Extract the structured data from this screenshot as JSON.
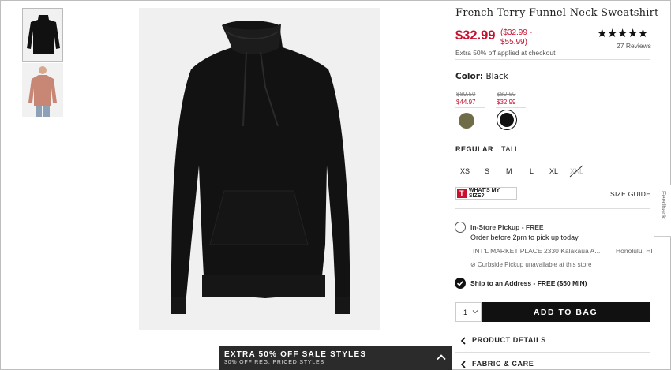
{
  "product": {
    "title": "French Terry Funnel-Neck Sweatshirt",
    "price": "$32.99",
    "price_range": "($32.99 - $55.99)",
    "extra_discount": "Extra 50% off applied at checkout",
    "rating": "★★★★★",
    "reviews": "27 Reviews"
  },
  "color": {
    "label": "Color:",
    "value": "Black",
    "swatches": [
      {
        "orig": "$89.50",
        "sale": "$44.97",
        "color": "#6f6d48"
      },
      {
        "orig": "$89.50",
        "sale": "$32.99",
        "color": "#111111",
        "selected": true
      }
    ]
  },
  "fit": {
    "options": [
      "REGULAR",
      "TALL"
    ],
    "selected": "REGULAR"
  },
  "sizes": [
    "XS",
    "S",
    "M",
    "L",
    "XL",
    "XXL"
  ],
  "size_tools": {
    "whats_my_size": "WHAT'S MY SIZE?",
    "size_guide": "SIZE GUIDE"
  },
  "pickup": {
    "title": "In-Store Pickup - FREE",
    "subtitle": "Order before 2pm to pick up today",
    "store": "INT'L MARKET PLACE 2330 Kalakaua A...",
    "city": "Honolulu, HI",
    "curbside": "⊘ Curbside Pickup unavailable at this store"
  },
  "ship": {
    "title": "Ship to an Address - FREE ($50 MIN)"
  },
  "cart": {
    "qty": "1",
    "add_label": "ADD TO BAG"
  },
  "accordions": [
    "PRODUCT DETAILS",
    "FABRIC & CARE"
  ],
  "banner": {
    "line1": "EXTRA 50% OFF SALE STYLES",
    "line2": "30% OFF REG. PRICED STYLES"
  },
  "feedback": "Feedback",
  "colors": {
    "sale_red": "#c8102e",
    "dark": "#111111"
  }
}
